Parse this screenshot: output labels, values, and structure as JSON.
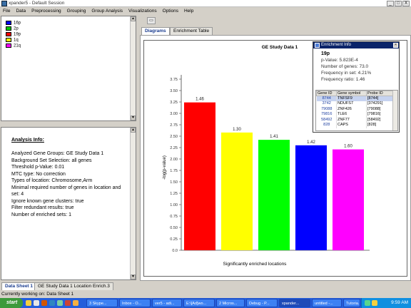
{
  "window": {
    "title": "xpander5 - Default Session",
    "buttons": [
      "_",
      "□",
      "X"
    ]
  },
  "menubar": [
    "File",
    "Data",
    "Preprocessing",
    "Grouping",
    "Group Analysis",
    "Visualizations",
    "Options",
    "Help"
  ],
  "legend": [
    {
      "label": "16p",
      "color": "#0000ff"
    },
    {
      "label": "2p",
      "color": "#00cc00"
    },
    {
      "label": "19p",
      "color": "#ff0000"
    },
    {
      "label": "1q",
      "color": "#ffff00"
    },
    {
      "label": "21q",
      "color": "#ff00ff"
    }
  ],
  "analysis": {
    "heading": "Analysis Info:",
    "lines": [
      "Analyzed Gene Groups: GE Study Data 1",
      "Background Set Selection: all genes",
      "Threshold p-Value: 0.01",
      "MTC type: No correction",
      "Types of location: Chromosome,Arm",
      "Minimal required number of genes in location and set: 4",
      "Ignore known gene clusters: true",
      "Filter redundant results: true",
      "Number of enriched sets: 1"
    ]
  },
  "tabs": [
    {
      "label": "Diagrams",
      "active": true
    },
    {
      "label": "Enrichment Table",
      "active": false
    }
  ],
  "chart_data": {
    "type": "bar",
    "title": "GE Study Data 1",
    "xlabel": "Significantly enriched locations",
    "ylabel": "-log(p-value)",
    "ylim": [
      0,
      3.75
    ],
    "yticks": [
      "0.0",
      "0.25",
      "0.50",
      "0.75",
      "1.00",
      "1.25",
      "1.50",
      "1.75",
      "2.00",
      "2.25",
      "2.50",
      "2.75",
      "3.00",
      "3.25",
      "3.50",
      "3.75"
    ],
    "categories": [
      "19p",
      "1q",
      "2p",
      "16p",
      "21q"
    ],
    "values": [
      3.24,
      2.58,
      2.42,
      2.3,
      2.21
    ],
    "labels": [
      "1.46",
      "1.30",
      "1.41",
      "1.42",
      "1.60"
    ],
    "colors": [
      "#ff0000",
      "#ffff00",
      "#00ff00",
      "#0000ff",
      "#ff00ff"
    ],
    "grid": false
  },
  "enrichment": {
    "title": "Enrichment Info",
    "location": "19p",
    "pvalue": "p-Value: 5.823E-4",
    "num_genes": "Number of genes: 73.0",
    "freq_set": "Frequency in set: 4.21%",
    "freq_ratio": "Frequency ratio: 1.46",
    "columns": [
      "Gene ID",
      "Gene symbol",
      "Probe ID"
    ],
    "rows": [
      [
        "8744",
        "TNFSF9",
        "[8744]"
      ],
      [
        "3742",
        "NDUFS7",
        "[374291]"
      ],
      [
        "79088",
        "ZNF426",
        "[79088]"
      ],
      [
        "79816",
        "TLE6",
        "[79816]"
      ],
      [
        "58492",
        "ZNF77",
        "[58492]"
      ],
      [
        "828",
        "CAPS",
        "[828]"
      ]
    ]
  },
  "sheet_tabs": [
    "Data Sheet 1",
    "GE Study Data 1 Location Enrich.3"
  ],
  "status": "Currently working on: Data Sheet 1",
  "taskbar": {
    "start": "start",
    "tasks": [
      "3 Skype...",
      "Inbox - O...",
      "ver5 - adi...",
      "E:\\[Ad]wo...",
      "2 Micros...",
      "Debug - P...",
      "xpander...",
      "untitled -...",
      "Tutoria..."
    ],
    "clock": "9:59 AM"
  }
}
